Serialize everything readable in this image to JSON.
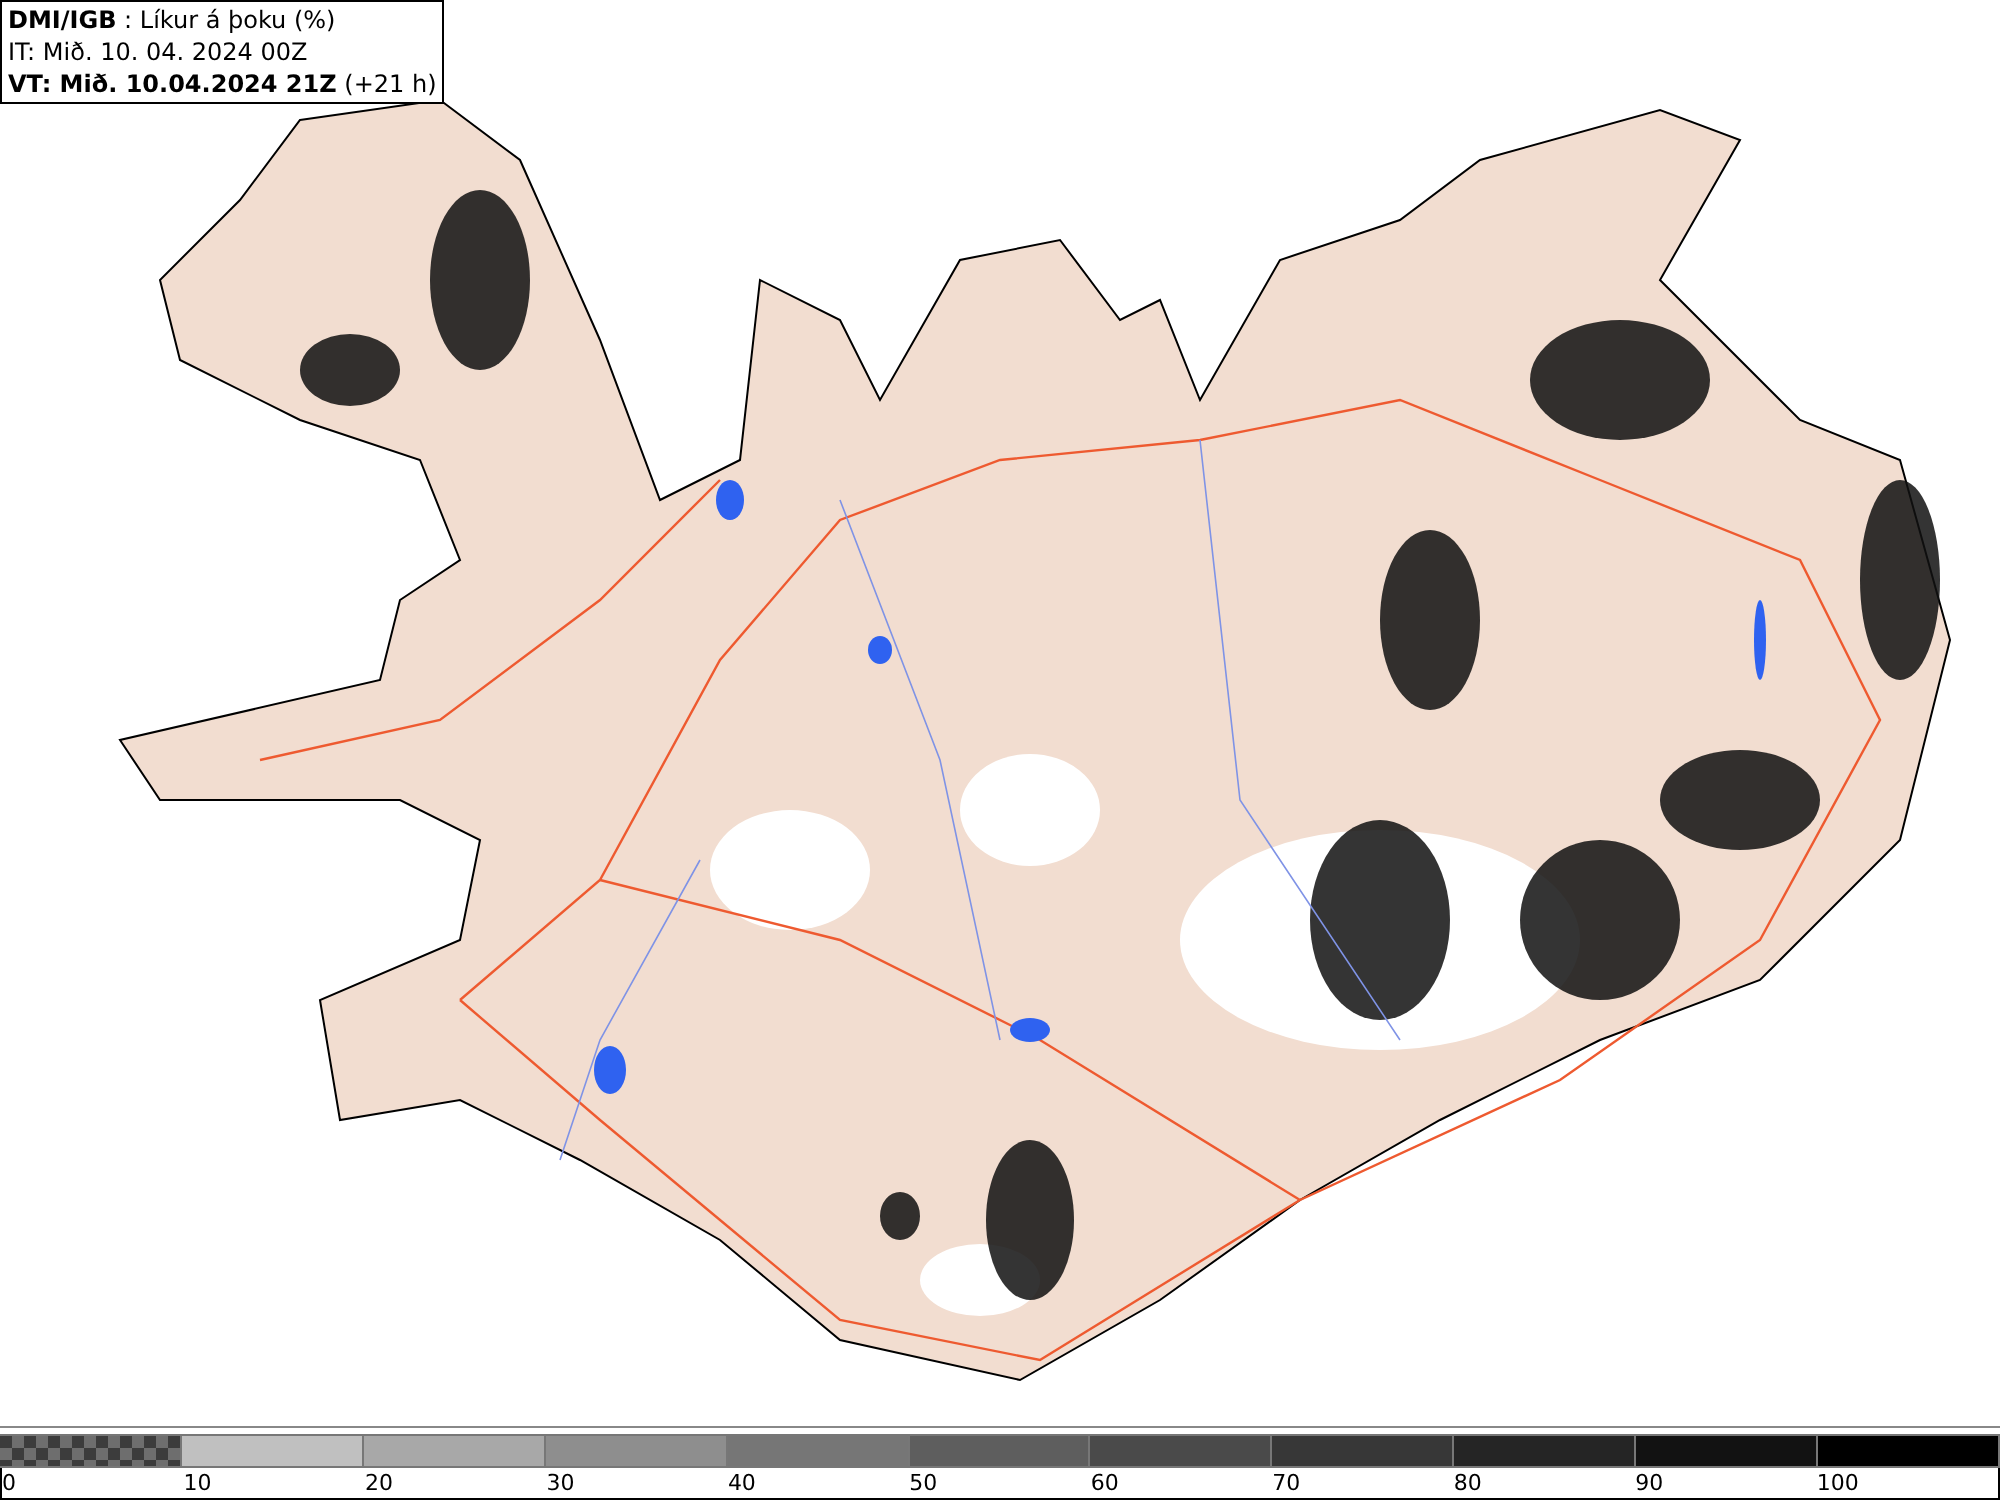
{
  "header": {
    "lines": [
      "**DMI/IGB** : Líkur á þoku (%)",
      "IT: Mið. 10. 04. 2024 00Z",
      "**VT: Mið. 10.04.2024 21Z** (+21 h)"
    ]
  },
  "legend": {
    "bins": [
      {
        "kind": "checker",
        "color": "#6e6e6e"
      },
      {
        "kind": "solid",
        "color": "#c0c0c0"
      },
      {
        "kind": "solid",
        "color": "#a8a8a8"
      },
      {
        "kind": "solid",
        "color": "#8e8e8e"
      },
      {
        "kind": "solid",
        "color": "#767676"
      },
      {
        "kind": "solid",
        "color": "#5e5e5e"
      },
      {
        "kind": "solid",
        "color": "#4a4a4a"
      },
      {
        "kind": "solid",
        "color": "#373737"
      },
      {
        "kind": "solid",
        "color": "#252525"
      },
      {
        "kind": "solid",
        "color": "#121212"
      },
      {
        "kind": "solid",
        "color": "#000000"
      }
    ],
    "labels": [
      "0",
      "10",
      "20",
      "30",
      "40",
      "50",
      "60",
      "70",
      "80",
      "90",
      "100"
    ]
  }
}
